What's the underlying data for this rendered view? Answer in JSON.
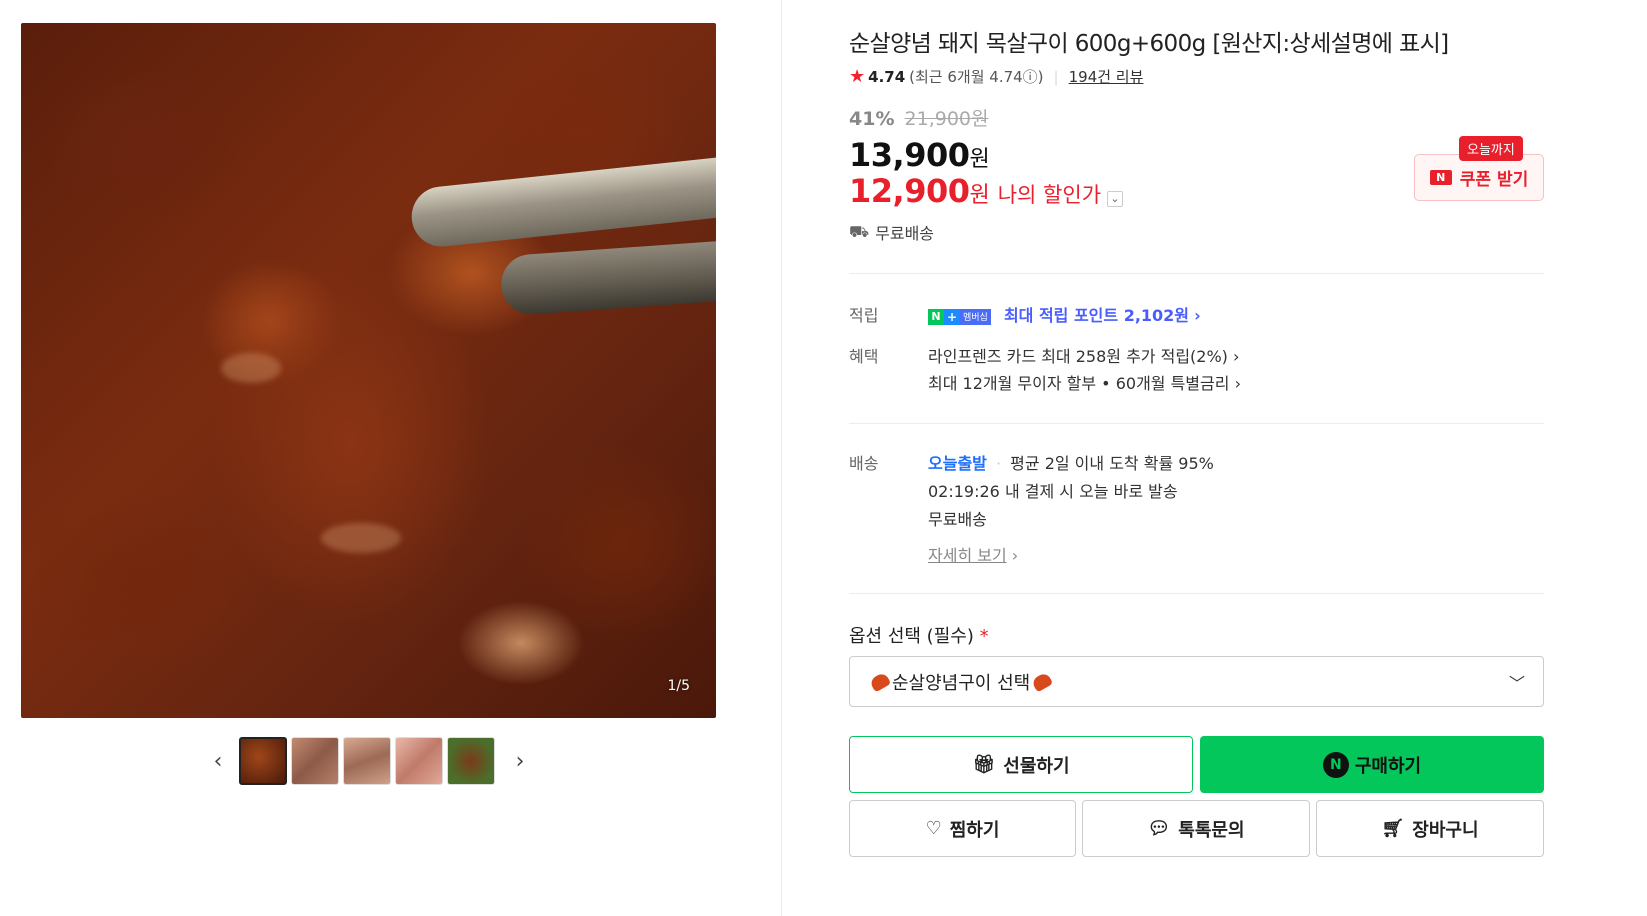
{
  "gallery": {
    "counter": "1/5",
    "prev_label": "‹",
    "next_label": "›"
  },
  "product": {
    "title": "순살양념 돼지 목살구이 600g+600g [원산지:상세설명에 표시]",
    "rating": "4.74",
    "recent_rating": "(최근 6개월 4.74ⓘ)",
    "review_count": "194건 리뷰",
    "discount_rate": "41%",
    "original_price": "21,900원",
    "price": "13,900",
    "price_unit": "원",
    "my_price": "12,900",
    "my_price_unit": "원",
    "my_price_label": "나의 할인가",
    "shipping": "무료배송"
  },
  "coupon": {
    "tag": "오늘까지",
    "label": "쿠폰 받기",
    "n_badge": "N"
  },
  "benefits": {
    "points_label": "적립",
    "points_text": "최대 적립 포인트 2,102원",
    "points_membership_badge": "멤버십",
    "benefit_label": "혜택",
    "benefit_line1": "라인프렌즈 카드 최대 258원 추가 적립(2%)",
    "benefit_line2": "최대 12개월 무이자 할부 • 60개월 특별금리"
  },
  "delivery": {
    "label": "배송",
    "today_ship": "오늘출발",
    "avg_text": "평균 2일 이내 도착 확률 95%",
    "countdown": "02:19:26  내 결제 시 오늘 바로 발송",
    "fee": "무료배송",
    "detail_link": "자세히 보기"
  },
  "options": {
    "label": "옵션 선택 (필수)",
    "required_mark": "*",
    "select_value": "순살양념구이 선택"
  },
  "actions": {
    "gift": "선물하기",
    "buy": "구매하기",
    "wish": "찜하기",
    "talk": "톡톡문의",
    "cart": "장바구니"
  },
  "colors": {
    "naver_green": "#03c75a",
    "sale_red": "#e8202c",
    "link_blue": "#1f6fff"
  }
}
